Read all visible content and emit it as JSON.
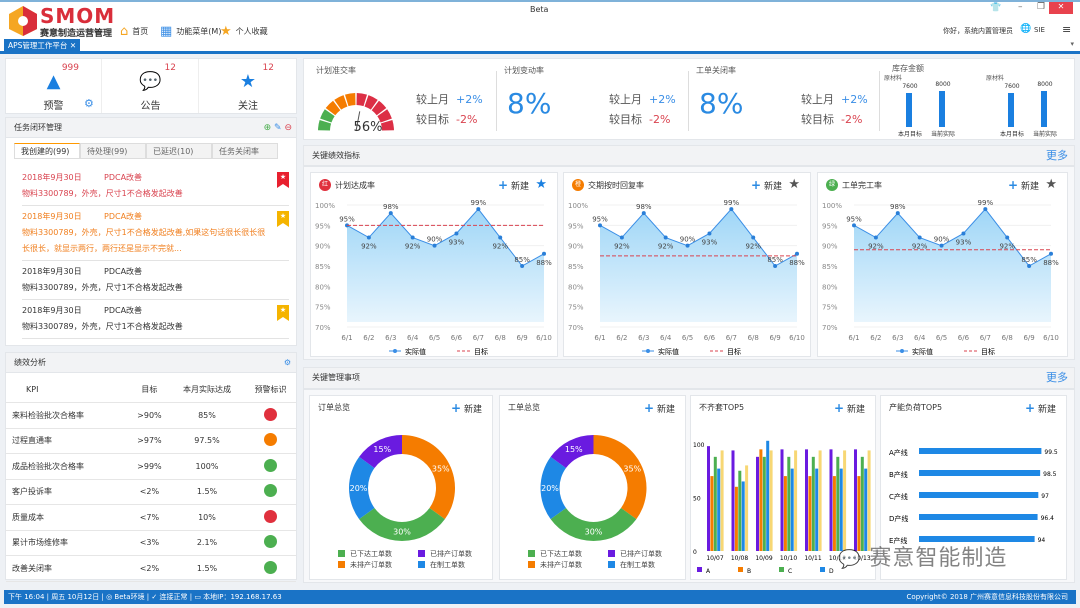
{
  "header": {
    "logo": "SMOM",
    "logo_sub": "赛意制造运营管理",
    "window_title": "Beta",
    "nav": [
      {
        "label": "首页",
        "icon": "home-icon"
      },
      {
        "label": "功能菜单(M)",
        "icon": "grid-menu-icon"
      },
      {
        "label": "个人收藏",
        "icon": "star-icon"
      }
    ],
    "greeting": "你好，系统内置管理员",
    "lang": "SIE"
  },
  "tab": {
    "label": "APS管理工作平台"
  },
  "stats": [
    {
      "label": "预警",
      "count": "999",
      "icon": "warning-icon"
    },
    {
      "label": "公告",
      "count": "12",
      "icon": "chat-icon"
    },
    {
      "label": "关注",
      "count": "12",
      "icon": "star-icon"
    }
  ],
  "tasks": {
    "title": "任务闭环管理",
    "tabs": [
      "我创建的(99)",
      "待处理(99)",
      "已延迟(10)",
      "任务关闭率"
    ],
    "items": [
      {
        "date": "2018年9月30日",
        "type": "PDCA改善",
        "text": "物料3300789，外壳，尺寸1不合格发起改善",
        "color": "#d9434f",
        "flag": "#e8202f"
      },
      {
        "date": "2018年9月30日",
        "type": "PDCA改善",
        "text": "物料3300789，外壳，尺寸1不合格发起改善,如果这句话很长很长很长很长，就显示两行，两行还是显示不完就...",
        "color": "#f07f1f",
        "flag": "#f5b400"
      },
      {
        "date": "2018年9月30日",
        "type": "PDCA改善",
        "text": "物料3300789，外壳，尺寸1不合格发起改善",
        "color": "#333",
        "flag": ""
      },
      {
        "date": "2018年9月30日",
        "type": "PDCA改善",
        "text": "物料3300789，外壳，尺寸1不合格发起改善",
        "color": "#333",
        "flag": "#f5b400"
      }
    ]
  },
  "perf": {
    "title": "绩效分析",
    "columns": [
      "KPI",
      "目标",
      "本月实际达成",
      "预警标识"
    ],
    "rows": [
      [
        "来料检验批次合格率",
        ">90%",
        "85%",
        "#e0303d"
      ],
      [
        "过程直通率",
        ">97%",
        "97.5%",
        "#f57c00"
      ],
      [
        "成品检验批次合格率",
        ">99%",
        "100%",
        "#4caf50"
      ],
      [
        "客户投诉率",
        "<2%",
        "1.5%",
        "#4caf50"
      ],
      [
        "质量成本",
        "<7%",
        "10%",
        "#e0303d"
      ],
      [
        "累计市场维修率",
        "<3%",
        "2.1%",
        "#4caf50"
      ],
      [
        "改善关闭率",
        "<2%",
        "1.5%",
        "#4caf50"
      ]
    ]
  },
  "kpis": {
    "gauge": {
      "title": "计划准交率",
      "value": 56
    },
    "cmp_month": "较上月",
    "cmp_target": "较目标",
    "up": "+2%",
    "down": "-2%",
    "items": [
      {
        "title": "计划变动率",
        "value": "8%"
      },
      {
        "title": "工单关闭率",
        "value": "8%"
      }
    ],
    "inventory": {
      "title": "库存金额",
      "groups": [
        {
          "name": "原材料",
          "bars": [
            {
              "label": "本月目标",
              "value": 7600
            },
            {
              "label": "当前实际",
              "value": 8000
            }
          ]
        },
        {
          "name": "原材料",
          "bars": [
            {
              "label": "本月目标",
              "value": 7600
            },
            {
              "label": "当前实际",
              "value": 8000
            }
          ]
        }
      ]
    }
  },
  "section1": {
    "title": "关键绩效指标",
    "more": "更多"
  },
  "section2": {
    "title": "关键管理事项",
    "more": "更多"
  },
  "new_label": "新建",
  "chart_data": [
    {
      "type": "line",
      "title": "计划达成率",
      "badge": "红",
      "badge_color": "#e0303d",
      "star_color": "#1a7fe0",
      "categories": [
        "6/1",
        "6/2",
        "6/3",
        "6/4",
        "6/5",
        "6/6",
        "6/7",
        "6/8",
        "6/9",
        "6/10"
      ],
      "series": [
        {
          "name": "实际值",
          "values": [
            95,
            92,
            98,
            92,
            90,
            93,
            99,
            92,
            85,
            88
          ]
        },
        {
          "name": "目标",
          "values": [
            95,
            95,
            95,
            95,
            95,
            95,
            95,
            95,
            95,
            95
          ]
        }
      ],
      "ylim": [
        70,
        100
      ],
      "yticks": [
        "70%",
        "75%",
        "80%",
        "85%",
        "90%",
        "95%",
        "100%"
      ]
    },
    {
      "type": "line",
      "title": "交期按时回复率",
      "badge": "橙",
      "badge_color": "#f57c00",
      "star_color": "#555",
      "categories": [
        "6/1",
        "6/2",
        "6/3",
        "6/4",
        "6/5",
        "6/6",
        "6/7",
        "6/8",
        "6/9",
        "6/10"
      ],
      "series": [
        {
          "name": "实际值",
          "values": [
            95,
            92,
            98,
            92,
            90,
            93,
            99,
            92,
            85,
            88
          ]
        },
        {
          "name": "目标",
          "values": [
            87.5,
            87.5,
            87.5,
            87.5,
            87.5,
            87.5,
            87.5,
            87.5,
            87.5,
            87.5
          ]
        }
      ],
      "ylim": [
        70,
        100
      ],
      "yticks": [
        "70%",
        "75%",
        "80%",
        "85%",
        "90%",
        "95%",
        "100%"
      ]
    },
    {
      "type": "line",
      "title": "工单完工率",
      "badge": "绿",
      "badge_color": "#4caf50",
      "star_color": "#555",
      "categories": [
        "6/1",
        "6/2",
        "6/3",
        "6/4",
        "6/5",
        "6/6",
        "6/7",
        "6/8",
        "6/9",
        "6/10"
      ],
      "series": [
        {
          "name": "实际值",
          "values": [
            95,
            92,
            98,
            92,
            90,
            93,
            99,
            92,
            85,
            88
          ]
        },
        {
          "name": "目标",
          "values": [
            89,
            89,
            89,
            89,
            89,
            89,
            89,
            89,
            89,
            89
          ]
        }
      ],
      "ylim": [
        70,
        100
      ],
      "yticks": [
        "70%",
        "75%",
        "80%",
        "85%",
        "90%",
        "95%",
        "100%"
      ]
    },
    {
      "type": "pie",
      "title": "订单总览",
      "slices": [
        {
          "name": "已下达工单数",
          "value": 30,
          "color": "#4caf50"
        },
        {
          "name": "在制工单数",
          "value": 20,
          "color": "#1e88e5"
        },
        {
          "name": "已排产订单数",
          "value": 15,
          "color": "#6a1be0"
        },
        {
          "name": "未排产订单数",
          "value": 35,
          "color": "#f57c00"
        }
      ]
    },
    {
      "type": "pie",
      "title": "工单总览",
      "slices": [
        {
          "name": "已下达工单数",
          "value": 30,
          "color": "#4caf50"
        },
        {
          "name": "在制工单数",
          "value": 20,
          "color": "#1e88e5"
        },
        {
          "name": "已排产订单数",
          "value": 15,
          "color": "#6a1be0"
        },
        {
          "name": "未排产订单数",
          "value": 35,
          "color": "#f57c00"
        }
      ]
    },
    {
      "type": "bar",
      "title": "不齐套TOP5",
      "categories": [
        "10/07",
        "10/08",
        "10/09",
        "10/10",
        "10/11",
        "10/12",
        "10/13"
      ],
      "ylim": [
        0,
        100
      ],
      "yticks": [
        0,
        50,
        100
      ],
      "legend": [
        "A",
        "B",
        "C",
        "D"
      ],
      "colors": [
        "#6a1be0",
        "#f57c00",
        "#4caf50",
        "#1e88e5",
        "#f7d774"
      ],
      "series": [
        {
          "name": "A",
          "values": [
            98,
            94,
            88,
            95,
            95,
            95,
            95
          ]
        },
        {
          "name": "B",
          "values": [
            70,
            60,
            95,
            70,
            70,
            70,
            70
          ]
        },
        {
          "name": "C",
          "values": [
            88,
            75,
            88,
            88,
            88,
            88,
            88
          ]
        },
        {
          "name": "D",
          "values": [
            77,
            65,
            103,
            77,
            77,
            77,
            77
          ]
        },
        {
          "values": [
            94,
            80,
            94,
            94,
            94,
            94,
            94
          ]
        }
      ]
    },
    {
      "type": "bar",
      "orientation": "horizontal",
      "title": "产能负荷TOP5",
      "categories": [
        "A产线",
        "B产线",
        "C产线",
        "D产线",
        "E产线"
      ],
      "values": [
        99.5,
        98.5,
        97,
        96.4,
        94
      ],
      "xlim": [
        0,
        100
      ],
      "color": "#1e88e5"
    }
  ],
  "status": {
    "time": "下午 16:04",
    "date": "周五 10月12日",
    "env": "Beta环境",
    "conn": "连接正常",
    "ip": "本地IP：192.168.17.63",
    "copyright": "Copyright© 2018 广州赛意信息科技股份有限公司"
  },
  "watermark": "赛意智能制造"
}
